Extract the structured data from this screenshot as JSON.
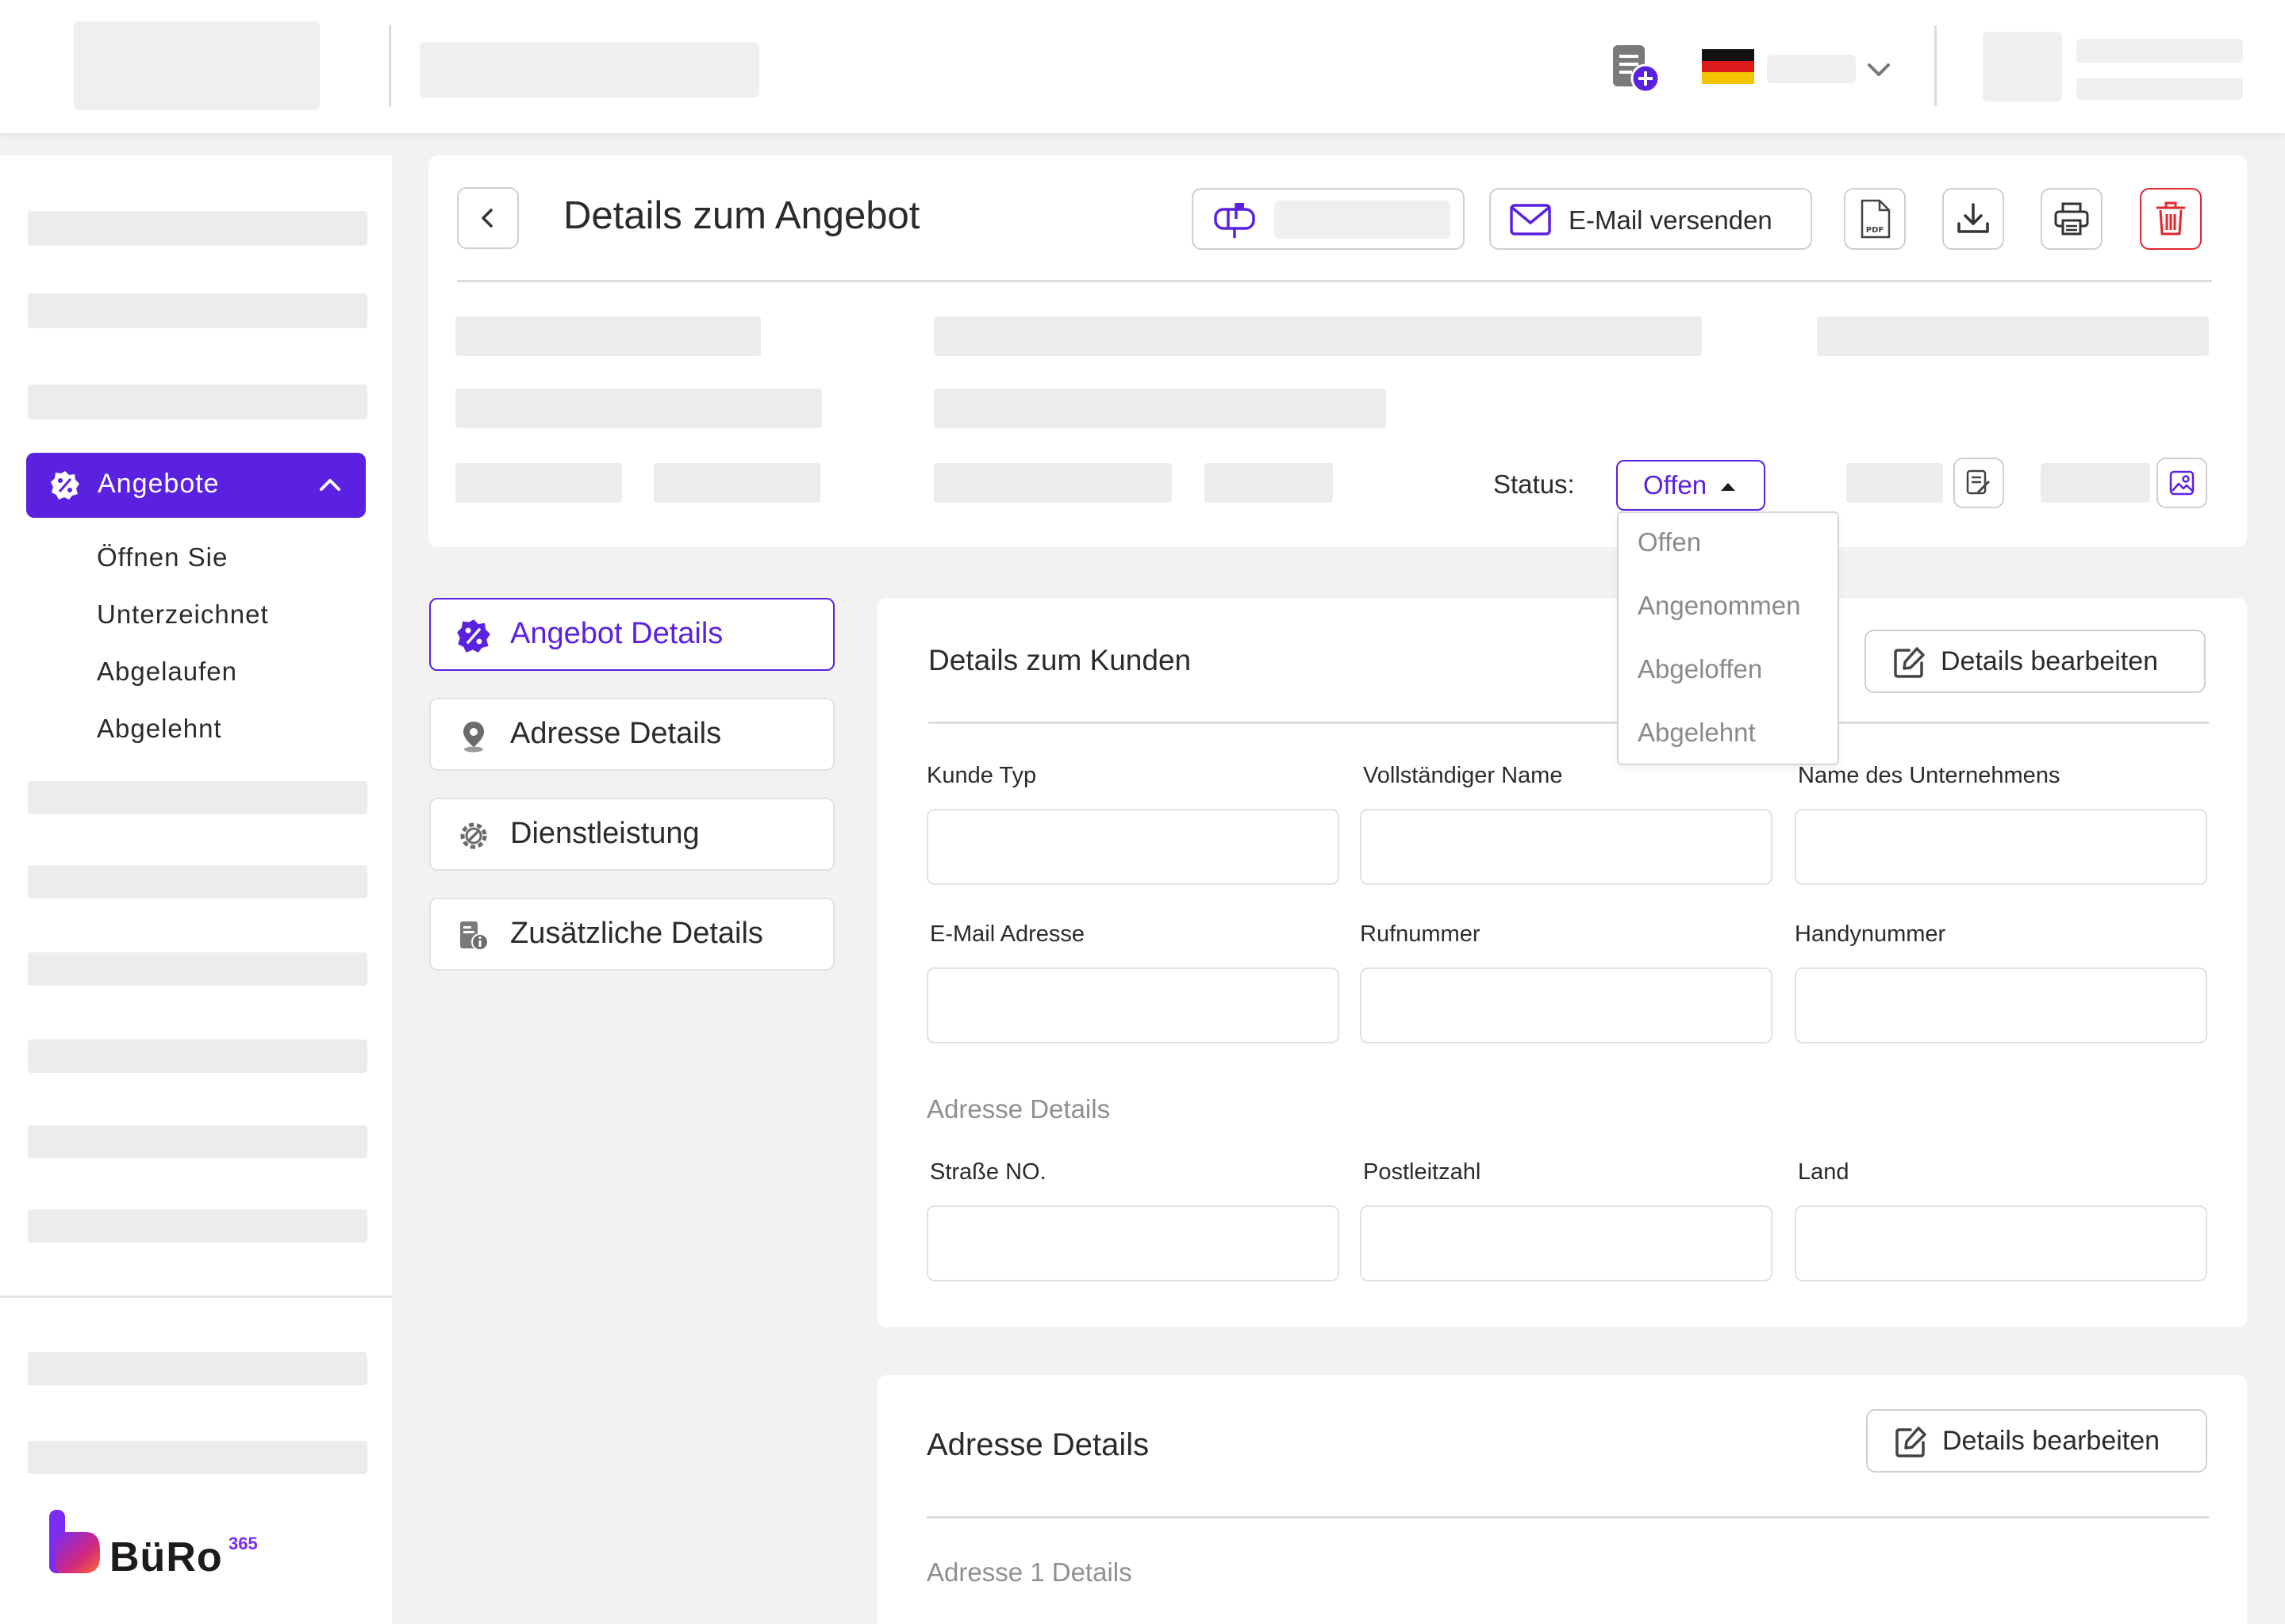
{
  "header": {
    "language_flag": "de-flag-icon"
  },
  "sidebar": {
    "active_item": {
      "label": "Angebote",
      "icon": "percent-badge-icon"
    },
    "sub_items": [
      "Öffnen Sie",
      "Unterzeichnet",
      "Abgelaufen",
      "Abgelehnt"
    ],
    "logo_text": "BüRo",
    "logo_superscript": "365"
  },
  "page": {
    "title": "Details zum Angebot",
    "email_button_label": "E-Mail versenden",
    "status_label": "Status:",
    "status_value": "Offen",
    "status_options": [
      "Offen",
      "Angenommen",
      "Abgeloffen",
      "Abgelehnt"
    ]
  },
  "tabs": [
    {
      "label": "Angebot Details",
      "icon": "percent-badge-icon"
    },
    {
      "label": "Adresse Details",
      "icon": "location-pin-icon"
    },
    {
      "label": "Dienstleistung",
      "icon": "gear-wrench-icon"
    },
    {
      "label": "Zusätzliche Details",
      "icon": "info-document-icon"
    }
  ],
  "customer_card": {
    "title": "Details zum Kunden",
    "edit_label": "Details bearbeiten",
    "fields_row1": [
      "Kunde Typ",
      "Vollständiger Name",
      "Name des Unternehmens"
    ],
    "fields_row2": [
      "E-Mail Adresse",
      "Rufnummer",
      "Handynummer"
    ],
    "address_section": "Adresse Details",
    "fields_row3": [
      "Straße NO.",
      "Postleitzahl",
      "Land"
    ]
  },
  "address_card": {
    "title": "Adresse Details",
    "edit_label": "Details bearbeiten",
    "subsection": "Adresse 1 Details"
  },
  "colors": {
    "accent": "#5b21e0",
    "delete": "#e0282e",
    "placeholder": "#efefef"
  }
}
